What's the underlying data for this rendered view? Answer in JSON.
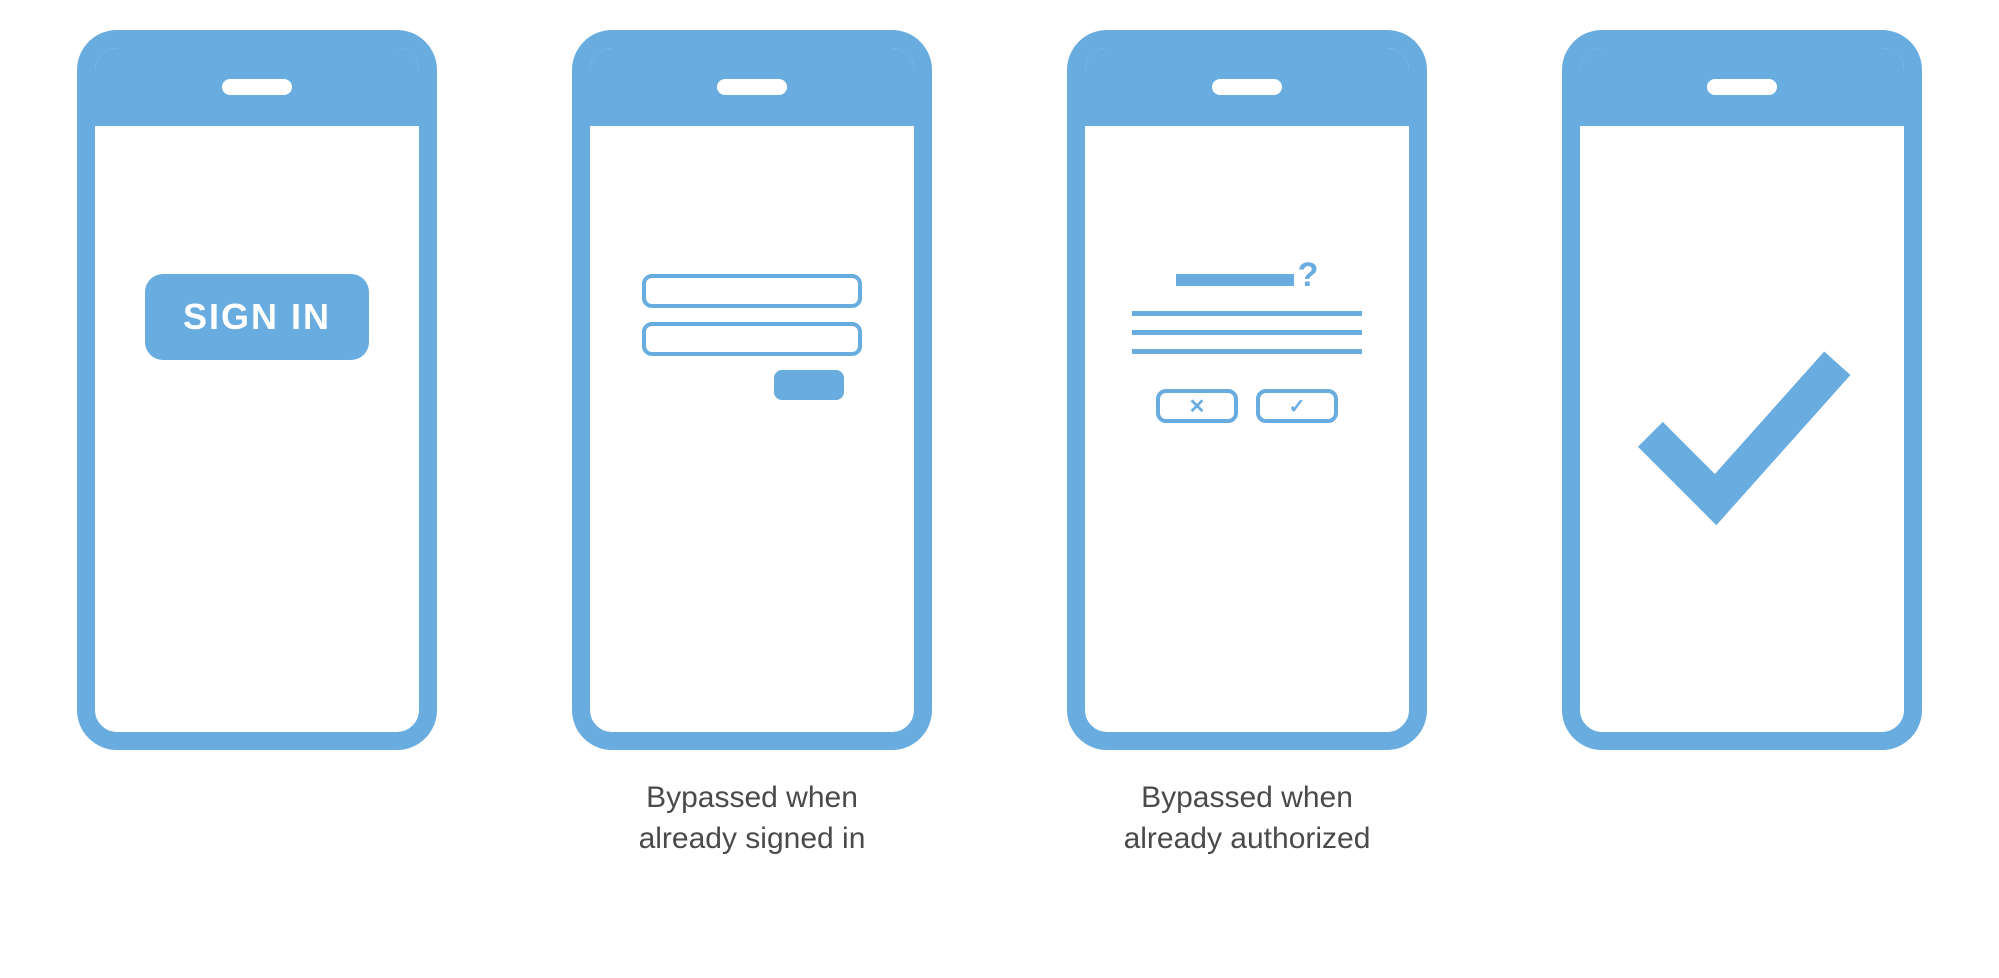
{
  "phones": [
    {
      "button_label": "SIGN IN",
      "caption": ""
    },
    {
      "caption": "Bypassed when\nalready signed in"
    },
    {
      "question_mark": "?",
      "x_label": "✕",
      "check_label": "✓",
      "caption": "Bypassed when\nalready authorized"
    },
    {
      "caption": ""
    }
  ],
  "color": "#68ace0"
}
